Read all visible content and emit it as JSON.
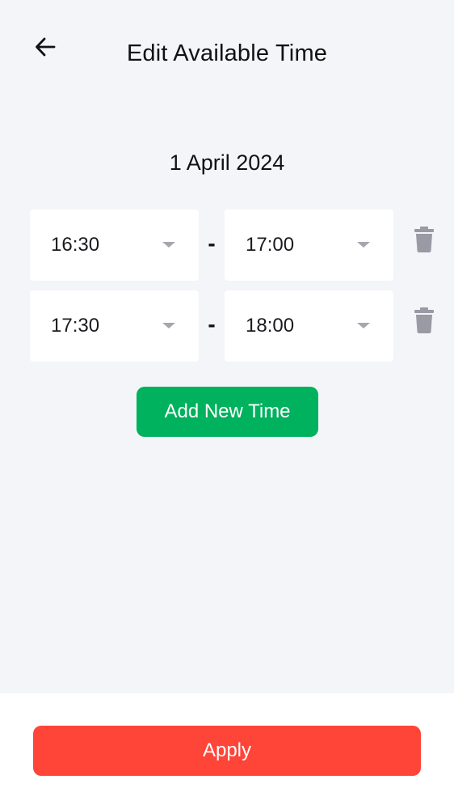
{
  "header": {
    "back_icon": "arrow-left-icon",
    "title": "Edit Available Time"
  },
  "date": "1 April 2024",
  "time_slots": [
    {
      "start": "16:30",
      "end": "17:00",
      "separator": "-",
      "delete_icon": "trash-icon"
    },
    {
      "start": "17:30",
      "end": "18:00",
      "separator": "-",
      "delete_icon": "trash-icon"
    }
  ],
  "add_button": {
    "label": "Add New Time",
    "color": "#00b15d"
  },
  "footer": {
    "apply_label": "Apply",
    "apply_color": "#ff4438"
  },
  "colors": {
    "background": "#f3f5f9",
    "select_background": "#ffffff",
    "trash_icon": "#9a9aa5",
    "caret": "#a6a6ae"
  }
}
